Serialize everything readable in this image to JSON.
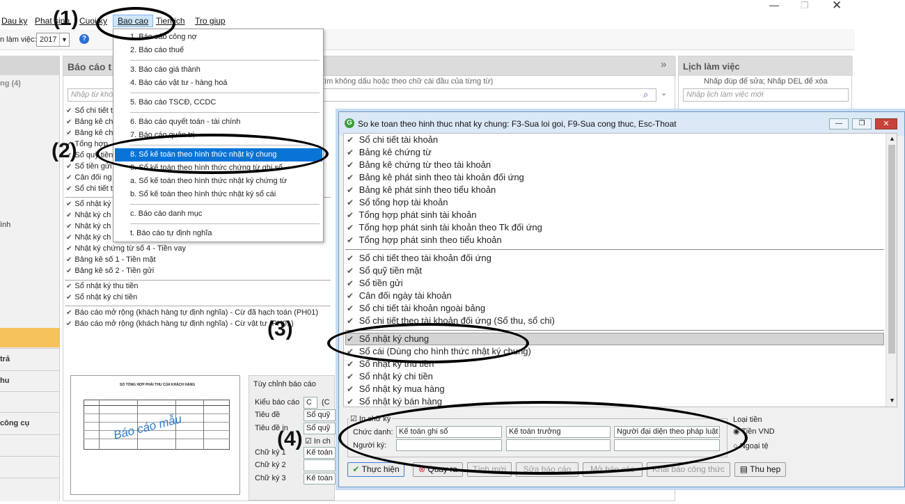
{
  "menu": {
    "items": [
      "Dau ky",
      "Phat sinh",
      "Cuoi ky",
      "Bao cao",
      "Tien ich",
      "Tro giup"
    ]
  },
  "toolbar": {
    "year_label": "n làm việc:",
    "year_value": "2017"
  },
  "leftnav": {
    "items": [
      "ng (4)",
      "ình",
      "trả",
      "hu",
      "công cụ"
    ]
  },
  "report_panel": {
    "title": "Báo cáo t",
    "search_hint": "tìm không dấu hoặc theo chữ cái đầu của từng từ)",
    "search_placeholder": "Nhập từ khó",
    "rows_group1": [
      "Sổ chi tiết t",
      "Bảng kê ch",
      "Bảng kê ch",
      "Tổng hợp",
      "Sổ quỹ tiền",
      "Sổ tiền gửi",
      "Cân đối ng",
      "Sổ chi tiết t"
    ],
    "rows_group2": [
      "Sổ nhật ký",
      "Nhật ký ch",
      "Nhật ký ch",
      "Nhật ký ch",
      "Nhật ký chứng từ số 4 - Tiền vay",
      "Bảng kê số 1 - Tiền mặt",
      "Bảng kê số 2 - Tiền gửi"
    ],
    "rows_group3": [
      "Sổ nhật ký thu tiền",
      "Sổ nhật ký chi tiền"
    ],
    "rows_group4": [
      "Báo cáo mở rộng (khách hàng tự định nghĩa) - Cừ đã hạch toán (PH01)",
      "Báo cáo mở rộng (khách hàng tự định nghĩa) - Cừ vật tư (PH01)"
    ],
    "thumb_title": "SỔ TỔNG HỢP PHẢI THU CỦA KHÁCH HÀNG",
    "thumb_watermark": "Báo cáo mẫu",
    "custom": {
      "title": "Tùy chỉnh báo cáo",
      "kieu_label": "Kiểu báo cáo",
      "kieu_value": "C",
      "kieu_extra": "(C",
      "tieude_label": "Tiêu đề",
      "tieude_value": "Sổ quỹ",
      "tieudein_label": "Tiêu đề in",
      "tieudein_value": "Sổ quỹ",
      "inchu": "In ch",
      "chuky1_label": "Chữ ký 1",
      "chuky1_value": "Kế toán",
      "chuky2_label": "Chữ ký 2",
      "chuky2_value": "",
      "chuky3_label": "Chữ ký 3",
      "chuky3_value": "Kế toán"
    }
  },
  "dropdown": {
    "items": [
      "1. Báo cáo công nợ",
      "2. Báo cáo thuế",
      "3. Báo cáo giá thành",
      "4. Báo cáo vật tư - hàng hoá",
      "5. Báo cáo TSCĐ, CCDC",
      "6. Báo cáo quyết toán - tài chính",
      "7. Báo cáo quản trị",
      "8. Sổ kế toán theo hình thức nhật ký chung",
      "9. Sổ kế toán theo hình thức chứng từ ghi sổ",
      "a. Sổ kế toán theo hình thức nhật ký chứng từ",
      "b. Sổ kế toán theo hình thức nhật ký sổ cái",
      "c. Báo cáo danh mục",
      "t. Báo cáo tự định nghĩa"
    ]
  },
  "lich": {
    "title": "Lịch làm việc",
    "hint": "Nhấp đúp để sửa; Nhấp DEL để xóa",
    "placeholder": "Nhập lịch làm việc mới"
  },
  "dialog": {
    "title": "So ke toan theo hinh thuc nhat ky chung: F3-Sua loi goi, F9-Sua cong thuc, Esc-Thoat",
    "group1": [
      "Sổ chi tiết tài khoản",
      "Bảng kê chứng từ",
      "Bảng kê chứng từ theo tài khoản",
      "Bảng kê phát sinh theo tài khoản đối ứng",
      "Bảng kê phát sinh theo tiểu khoản",
      "Sổ tổng hợp tài khoản",
      "Tổng hợp phát sinh tài khoản",
      "Tổng hợp phát sinh tài khoản theo Tk đối ứng",
      "Tổng hợp phát sinh theo tiểu khoản"
    ],
    "group2": [
      "Sổ chi tiết theo tài khoản đối ứng",
      "Sổ quỹ tiền mặt",
      "Sổ tiền gửi",
      "Cân đối ngày tài khoản",
      "Sổ chi tiết tài khoản ngoài bảng",
      "Sổ chi tiết theo tài khoản đối ứng (Sổ thu, sổ chi)"
    ],
    "group3": [
      "Sổ nhật ký chung",
      "Sổ cái (Dùng cho hình thức nhật ký chung)",
      "Sổ nhật ký thu tiền",
      "Sổ nhật ký chi tiền",
      "Sổ nhật ký mua hàng",
      "Sổ nhật ký bán hàng"
    ],
    "sign": {
      "group_label": "In chữ ký",
      "chucdanh_label": "Chức danh:",
      "nguoiky_label": "Người ký:",
      "chucdanh_values": [
        "Kế toán ghi sổ",
        "Kế toán trưởng",
        "Người đại diện theo pháp luật"
      ],
      "nguoiky_values": [
        "",
        "",
        ""
      ]
    },
    "currency": {
      "label": "Loại tiền",
      "opt1": "Tiền VND",
      "opt2": "Ngoại tệ"
    },
    "buttons": {
      "run": "Thực hiện",
      "back": "Quay ra",
      "b3": "Tính mới",
      "b4": "Sửa báo cáo",
      "b5": "Mở báo cáo",
      "b6": "Khai báo công thức",
      "narrow": "Thu hẹp"
    }
  },
  "annotations": {
    "a1": "(1)",
    "a2": "(2)",
    "a3": "(3)",
    "a4": "(4)"
  }
}
